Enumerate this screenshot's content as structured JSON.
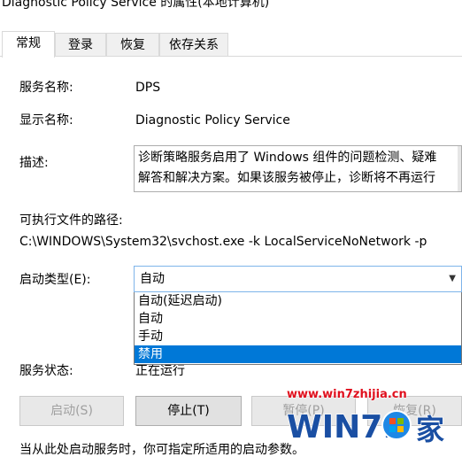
{
  "window": {
    "title": "Diagnostic Policy Service 的属性(本地计算机)"
  },
  "tabs": [
    {
      "label": "常规",
      "active": true
    },
    {
      "label": "登录",
      "active": false
    },
    {
      "label": "恢复",
      "active": false
    },
    {
      "label": "依存关系",
      "active": false
    }
  ],
  "general": {
    "service_name_label": "服务名称:",
    "service_name_value": "DPS",
    "display_name_label": "显示名称:",
    "display_name_value": "Diagnostic Policy Service",
    "description_label": "描述:",
    "description_line1": "诊断策略服务启用了 Windows 组件的问题检测、疑难",
    "description_line2": "解答和解决方案。如果该服务被停止，诊断将不再运行",
    "exe_path_label": "可执行文件的路径:",
    "exe_path_value": "C:\\WINDOWS\\System32\\svchost.exe -k LocalServiceNoNetwork -p",
    "startup_type_label": "启动类型(E):",
    "startup_type_value": "自动",
    "startup_options": [
      "自动(延迟启动)",
      "自动",
      "手动",
      "禁用"
    ],
    "startup_highlighted_index": 3,
    "status_label": "服务状态:",
    "status_value": "正在运行",
    "hint_text": "当从此处启动服务时，你可指定所适用的启动参数。"
  },
  "buttons": {
    "start": "启动(S)",
    "stop": "停止(T)",
    "pause": "暂停(P)",
    "resume": "恢复(R)"
  },
  "watermark": {
    "url": "www.win7zhijia.cn",
    "logo_text": "WIN7.",
    "logo_char": "家",
    "colors": {
      "url": "#e0101e",
      "logo": "#1a4fa3",
      "orb": "#1e88e5"
    }
  }
}
